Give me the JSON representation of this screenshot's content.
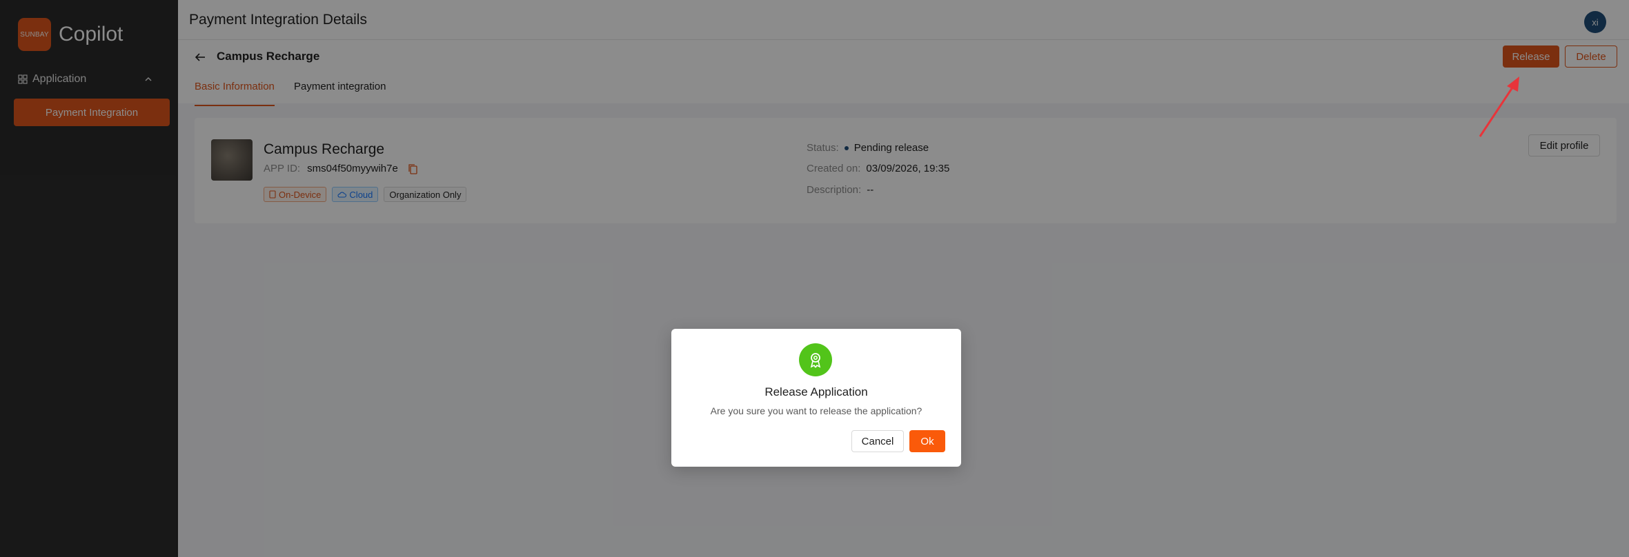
{
  "sidebar": {
    "logo_text": "SUNBAY",
    "brand_name": "Copilot",
    "group_label": "Application",
    "items": [
      {
        "label": "Payment Integration",
        "active": true
      }
    ]
  },
  "header": {
    "title": "Payment Integration Details",
    "avatar_initials": "xi"
  },
  "subheader": {
    "app_name": "Campus Recharge",
    "release_label": "Release",
    "delete_label": "Delete",
    "tabs": [
      {
        "label": "Basic Information",
        "active": true
      },
      {
        "label": "Payment integration",
        "active": false
      }
    ]
  },
  "card": {
    "title": "Campus Recharge",
    "app_id_label": "APP ID:",
    "app_id": "sms04f50myywih7e",
    "badges": [
      "On-Device",
      "Cloud",
      "Organization Only"
    ],
    "status_label": "Status:",
    "status_value": "Pending release",
    "created_label": "Created on:",
    "created_value": "03/09/2026, 19:35",
    "description_label": "Description:",
    "description_value": "--",
    "edit_label": "Edit profile"
  },
  "modal": {
    "title": "Release Application",
    "message": "Are you sure you want to release the application?",
    "cancel_label": "Cancel",
    "ok_label": "Ok"
  },
  "colors": {
    "accent": "#e0561c",
    "ok_button": "#fa5a0a",
    "success_icon": "#52c41a",
    "sidebar_bg": "#2b2b2b",
    "annotation_arrow": "#e8343a"
  },
  "icons": {
    "nav_group": "grid-icon",
    "collapse": "chevron-up-icon",
    "back": "arrow-left-icon",
    "copy": "copy-icon",
    "device": "device-icon",
    "cloud": "cloud-icon",
    "modal": "award-ribbon-icon"
  }
}
